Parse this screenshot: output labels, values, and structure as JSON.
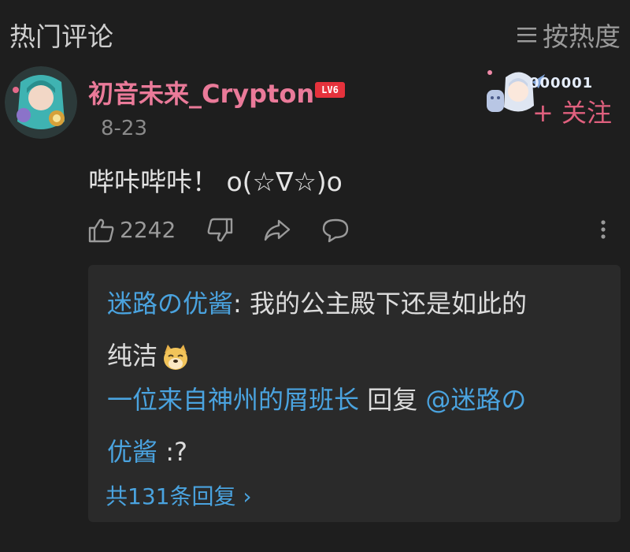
{
  "header": {
    "title": "热门评论",
    "sort_label": "按热度",
    "sort_icon": "menu-icon"
  },
  "comment": {
    "username": "初音未来_Crypton",
    "level_badge": "LV6",
    "date": "8-23",
    "fan_badge_number": "000001",
    "follow_label": "+ 关注",
    "text": "哔咔哔咔！ o(☆∇☆)o",
    "likes": "2242",
    "icons": [
      "thumb-up-icon",
      "thumb-down-icon",
      "share-icon",
      "comment-icon",
      "more-icon"
    ]
  },
  "replies": [
    {
      "user": "迷路の优酱",
      "separator": ": ",
      "text_line1": "我的公主殿下还是如此的",
      "text_line2": "纯洁",
      "emoji": "doge-emoji"
    },
    {
      "user": "一位来自神州的屑班长",
      "reply_word": " 回复 ",
      "mention_line1": "@迷路の",
      "mention_line2": "优酱",
      "text": " :?"
    }
  ],
  "view_more": "共131条回复 ›",
  "colors": {
    "background": "#1e1e1e",
    "reply_box": "#2a2a2a",
    "username_pink": "#ea7a99",
    "link_blue": "#4aa3df",
    "level_red": "#e5323c"
  }
}
